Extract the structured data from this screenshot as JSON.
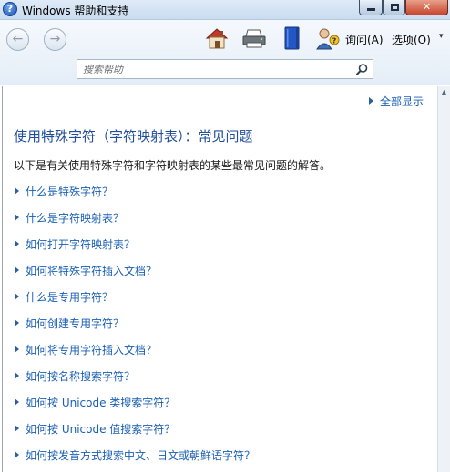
{
  "window": {
    "title": "Windows 帮助和支持",
    "help_glyph": "?",
    "close_glyph": "✕"
  },
  "toolbar": {
    "back_glyph": "←",
    "forward_glyph": "→",
    "ask_label": "询问(A)",
    "options_label": "选项(O)",
    "chevron": "▾"
  },
  "search": {
    "placeholder": "搜索帮助"
  },
  "content": {
    "show_all": "全部显示",
    "title": "使用特殊字符（字符映射表）：常见问题",
    "intro": "以下是有关使用特殊字符和字符映射表的某些最常见问题的解答。",
    "links": [
      "什么是特殊字符？",
      "什么是字符映射表？",
      "如何打开字符映射表？",
      "如何将特殊字符插入文档？",
      "什么是专用字符？",
      "如何创建专用字符？",
      "如何将专用字符插入文档？",
      "如何按名称搜索字符？",
      "如何按 Unicode 类搜索字符？",
      "如何按 Unicode 值搜索字符？",
      "如何按发音方式搜索中文、日文或朝鲜语字符？"
    ]
  },
  "colors": {
    "link": "#1a5fb4",
    "title": "#1f4e9b"
  },
  "icons": [
    "help-icon",
    "home-icon",
    "printer-icon",
    "help-book-icon",
    "ask-person-icon",
    "search-icon"
  ]
}
